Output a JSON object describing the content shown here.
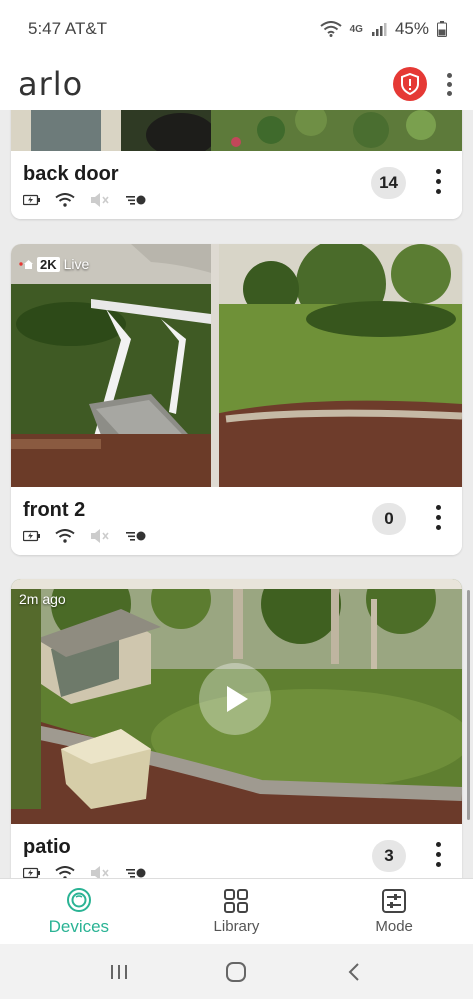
{
  "status_bar": {
    "time": "5:47 AT&T",
    "network_label": "4G",
    "battery": "45%"
  },
  "header": {
    "logo": "arlo",
    "icons": [
      "alert-shield-icon",
      "more-vertical-icon"
    ],
    "accent_color": "#e53935"
  },
  "cameras": [
    {
      "name": "back door",
      "count": "14",
      "status_icons": [
        "battery-charging-icon",
        "wifi-icon",
        "speaker-muted-icon",
        "motion-toggle-icon"
      ]
    },
    {
      "name": "front 2",
      "count": "0",
      "overlay_resolution": "2K",
      "overlay_status": "Live",
      "status_icons": [
        "battery-charging-icon",
        "wifi-icon",
        "speaker-muted-icon",
        "motion-toggle-icon"
      ]
    },
    {
      "name": "patio",
      "count": "3",
      "overlay_time": "2m ago",
      "status_icons": [
        "battery-charging-icon",
        "wifi-icon",
        "speaker-muted-icon",
        "motion-toggle-icon"
      ]
    }
  ],
  "bottom_nav": {
    "items": [
      {
        "label": "Devices",
        "icon": "devices-icon",
        "active": true
      },
      {
        "label": "Library",
        "icon": "library-grid-icon",
        "active": false
      },
      {
        "label": "Mode",
        "icon": "mode-sliders-icon",
        "active": false
      }
    ],
    "active_color": "#2ab394"
  },
  "system_nav": {
    "icons": [
      "recents-icon",
      "home-icon",
      "back-icon"
    ]
  }
}
